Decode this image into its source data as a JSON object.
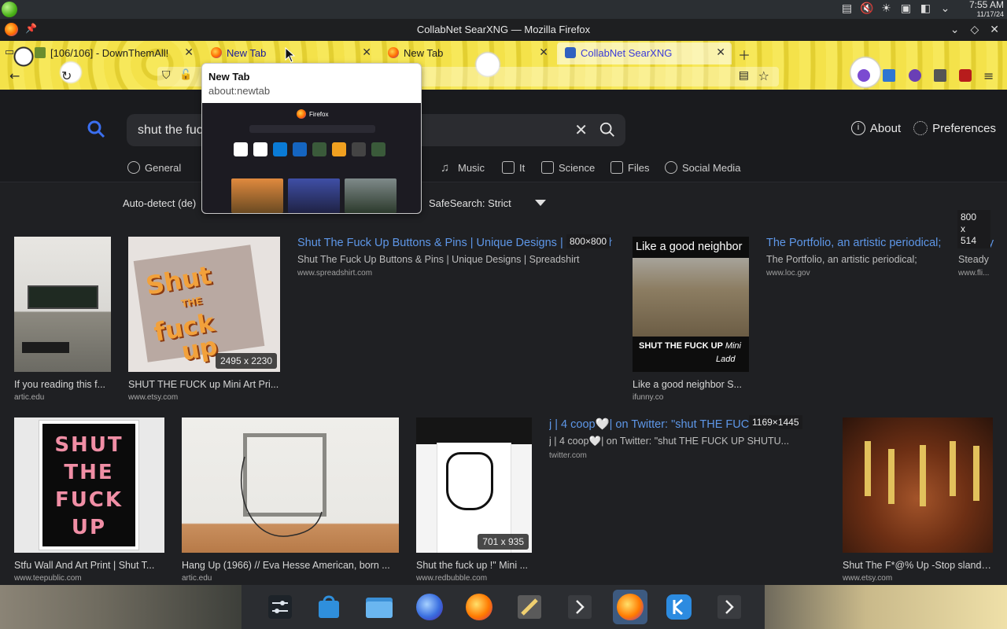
{
  "system": {
    "clock_time": "7:55 AM",
    "clock_date": "11/17/24",
    "tray_icons": [
      "clipboard-icon",
      "volume-muted-icon",
      "brightness-icon",
      "save-icon",
      "network-icon",
      "chevron-down-icon"
    ]
  },
  "window": {
    "title": "CollabNet SearXNG — Mozilla Firefox"
  },
  "tabs": [
    {
      "label": "[106/106] - DownThemAll!",
      "active": false
    },
    {
      "label": "New Tab",
      "active": false,
      "hovered": true
    },
    {
      "label": "New Tab",
      "active": false
    },
    {
      "label": "CollabNet SearXNG",
      "active": true
    }
  ],
  "tooltip": {
    "title": "New Tab",
    "url": "about:newtab",
    "preview_brand": "Firefox"
  },
  "search": {
    "query": "shut the fuck up",
    "visible_query": "shut the fuc"
  },
  "header_links": {
    "about": "About",
    "preferences": "Preferences"
  },
  "categories": [
    {
      "label": "General",
      "icon": "search-icon"
    },
    {
      "label": "Music",
      "icon": "music-note-icon"
    },
    {
      "label": "It",
      "icon": "layers-icon"
    },
    {
      "label": "Science",
      "icon": "science-icon"
    },
    {
      "label": "Files",
      "icon": "files-icon"
    },
    {
      "label": "Social Media",
      "icon": "people-icon"
    }
  ],
  "filters": {
    "language": "Auto-detect (de)",
    "safesearch": "SafeSearch: Strict"
  },
  "results": {
    "r1": {
      "caption": "If you reading this f...",
      "domain": "artic.edu"
    },
    "r2": {
      "caption": "SHUT THE FUCK up Mini Art Pri...",
      "domain": "www.etsy.com",
      "dims": "2495 x 2230",
      "thumb_text_1": "Shut",
      "thumb_text_2": "THE",
      "thumb_text_3": "fuck",
      "thumb_text_4": "up"
    },
    "r3": {
      "title": "Shut The Fuck Up Buttons & Pins | Unique Designs | Spreadshirt",
      "snippet": "Shut The Fuck Up Buttons & Pins | Unique Designs | Spreadshirt",
      "domain": "www.spreadshirt.com",
      "badge": "800×800"
    },
    "r4": {
      "caption": "Like a good neighbor S...",
      "domain": "ifunny.co",
      "thumb_top": "Like a good neighbor",
      "thumb_bottom": "SHUT THE FUCK UP",
      "thumb_bottom2": "Mini",
      "thumb_bottom3": "Ladd"
    },
    "r5": {
      "title": "The Portfolio, an artistic periodical;",
      "snippet": "The Portfolio, an artistic periodical;",
      "domain": "www.loc.gov"
    },
    "r6": {
      "title": "Steady",
      "snippet": "Steady",
      "domain": "www.fli...",
      "badge_1": "800",
      "badge_2": "x",
      "badge_3": "514"
    },
    "r7": {
      "caption": "Stfu Wall And Art Print | Shut T...",
      "domain": "www.teepublic.com",
      "thumb_lines": [
        "SHUT",
        "THE",
        "FUCK",
        "UP"
      ]
    },
    "r8": {
      "caption": "Hang Up (1966) // Eva Hesse American, born ...",
      "domain": "artic.edu"
    },
    "r9": {
      "caption": "Shut the fuck up !\" Mini ...",
      "domain": "www.redbubble.com",
      "dims": "701 x 935"
    },
    "r10": {
      "title": "j | 4 coop🤍| on Twitter: \"shut THE FUCK UP",
      "snippet": "j | 4 coop🤍| on Twitter: \"shut THE FUCK UP SHUTU...",
      "domain": "twitter.com",
      "badge": "1169×1445"
    },
    "r11": {
      "caption": "Shut The F*@% Up -Stop slande...",
      "domain": "www.etsy.com"
    }
  },
  "dock": [
    "settings-icon",
    "store-icon",
    "folder-icon",
    "firefox-nightly-icon",
    "firefox-icon",
    "text-editor-icon",
    "arrow-icon",
    "firefox-active-icon",
    "kde-connect-icon",
    "arrow-icon"
  ]
}
